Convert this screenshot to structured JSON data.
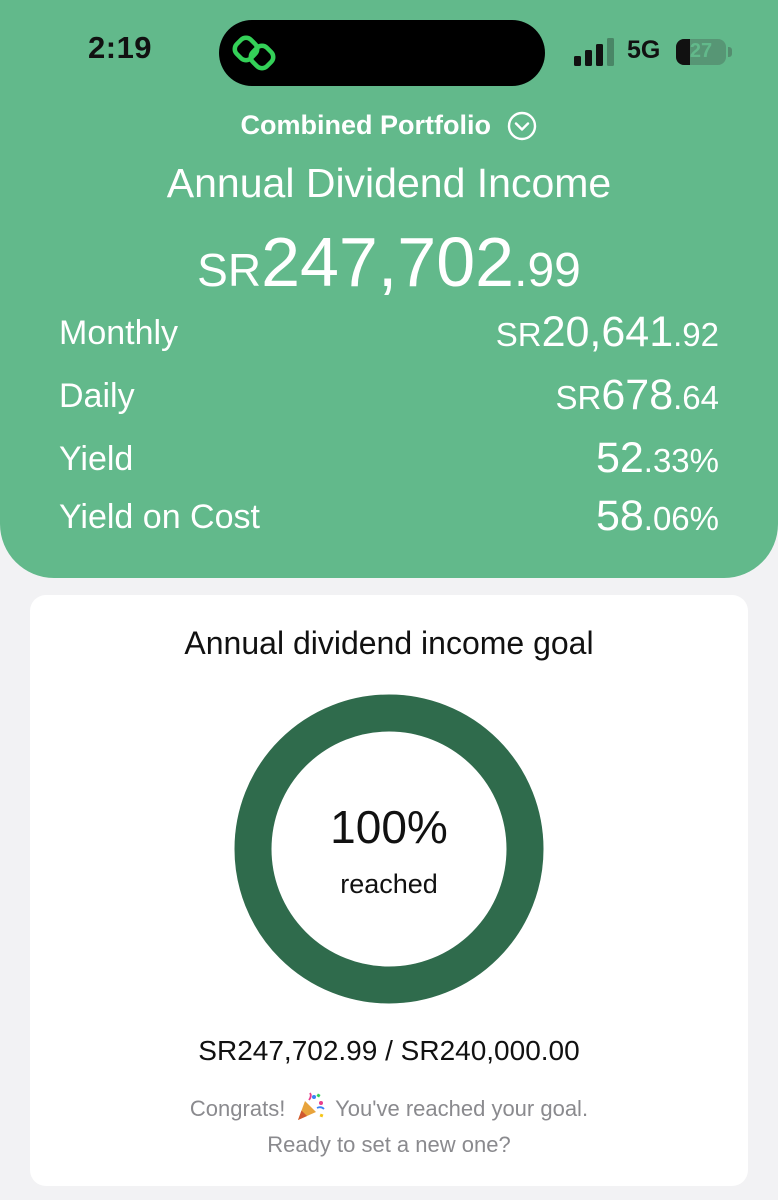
{
  "status_bar": {
    "time": "2:19",
    "network": "5G",
    "battery_level": "27",
    "battery_fraction": 0.27
  },
  "header": {
    "portfolio_name": "Combined Portfolio",
    "title": "Annual Dividend Income",
    "annual": {
      "currency": "SR",
      "integer": "247,702",
      "decimal": ".99"
    },
    "stats": [
      {
        "label": "Monthly",
        "currency": "SR",
        "integer": "20,641",
        "decimal": ".92",
        "suffix": ""
      },
      {
        "label": "Daily",
        "currency": "SR",
        "integer": "678",
        "decimal": ".64",
        "suffix": ""
      },
      {
        "label": "Yield",
        "currency": "",
        "integer": "52",
        "decimal": ".33",
        "suffix": "%"
      },
      {
        "label": "Yield on Cost",
        "currency": "",
        "integer": "58",
        "decimal": ".06",
        "suffix": "%"
      }
    ]
  },
  "goal": {
    "title": "Annual dividend income goal",
    "percent_text": "100%",
    "progress": 1.0,
    "reached_label": "reached",
    "amounts": "SR247,702.99 / SR240,000.00",
    "message_part1": "Congrats!",
    "message_part2": "You've reached your goal.",
    "message_line2": "Ready to set a new one?"
  },
  "colors": {
    "header_green": "#62b98b",
    "ring_green": "#2f6b4c",
    "island_icon_green": "#34d058",
    "card_bg": "#ffffff",
    "page_bg": "#f2f2f4",
    "muted_text": "#8a8a8e"
  },
  "icons": {
    "island": "link-rings-icon",
    "portfolio_toggle": "chevron-down-circle-icon",
    "message": "party-popper-icon"
  }
}
